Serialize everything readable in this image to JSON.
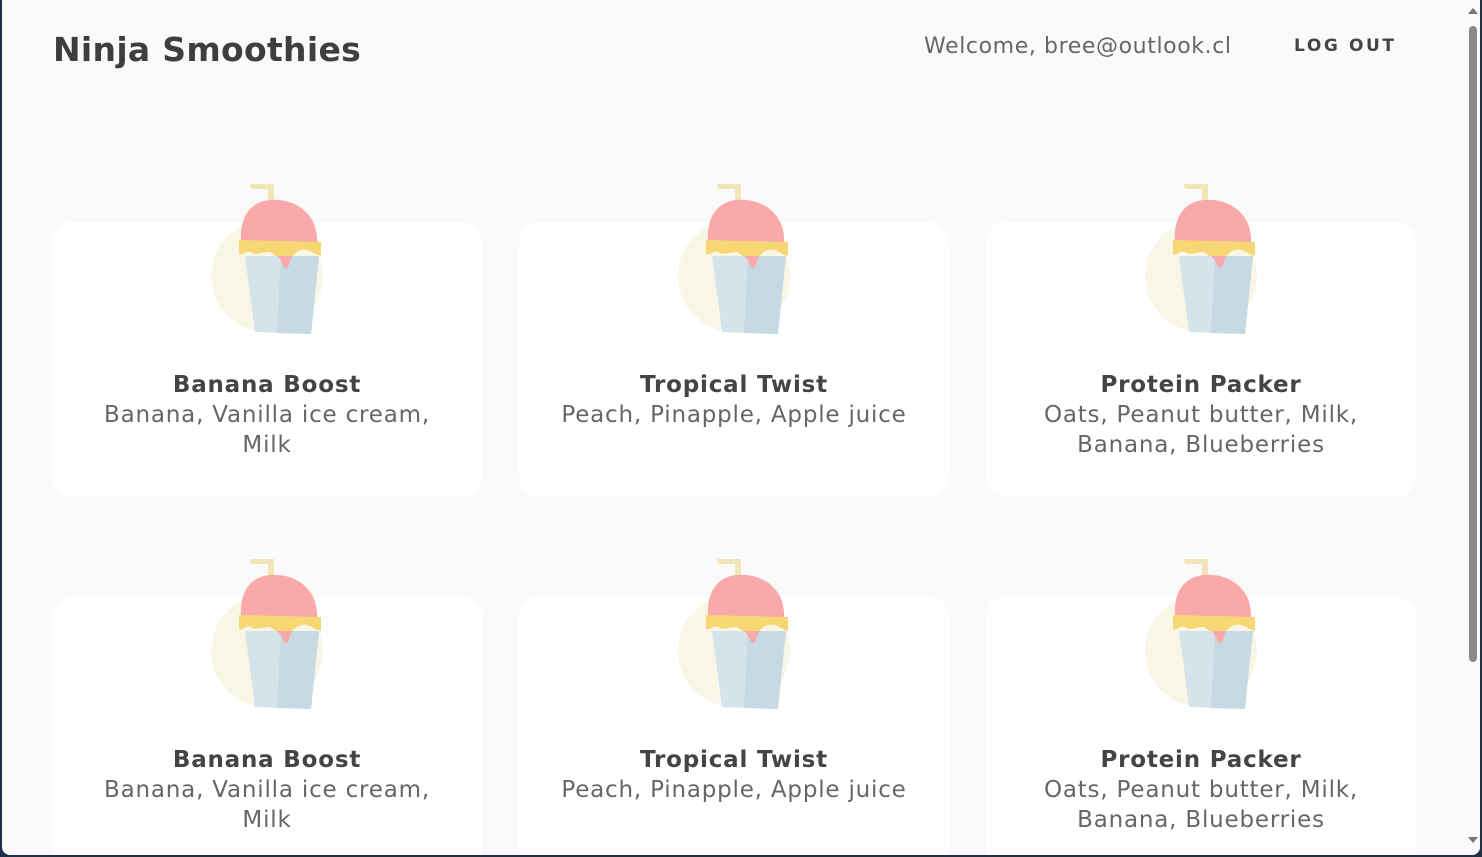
{
  "navbar": {
    "brand": "Ninja Smoothies",
    "welcome": "Welcome, bree@outlook.cl",
    "logout_label": "LOG OUT"
  },
  "cards": [
    {
      "title": "Banana Boost",
      "ingredients": "Banana, Vanilla ice cream, Milk",
      "icon": "smoothie-cup-icon"
    },
    {
      "title": "Tropical Twist",
      "ingredients": "Peach, Pinapple, Apple juice",
      "icon": "smoothie-cup-icon"
    },
    {
      "title": "Protein Packer",
      "ingredients": "Oats, Peanut butter, Milk, Banana, Blueberries",
      "icon": "smoothie-cup-icon"
    },
    {
      "title": "Banana Boost",
      "ingredients": "Banana, Vanilla ice cream, Milk",
      "icon": "smoothie-cup-icon"
    },
    {
      "title": "Tropical Twist",
      "ingredients": "Peach, Pinapple, Apple juice",
      "icon": "smoothie-cup-icon"
    },
    {
      "title": "Protein Packer",
      "ingredients": "Oats, Peanut butter, Milk, Banana, Blueberries",
      "icon": "smoothie-cup-icon"
    }
  ],
  "colors": {
    "background": "#fafafa",
    "card": "#ffffff",
    "title_text": "#444444",
    "body_text": "#666666",
    "smoothie_pink": "#f9a9a9",
    "smoothie_yellow": "#f7d774",
    "cup_blue": "#d5e3ea"
  }
}
